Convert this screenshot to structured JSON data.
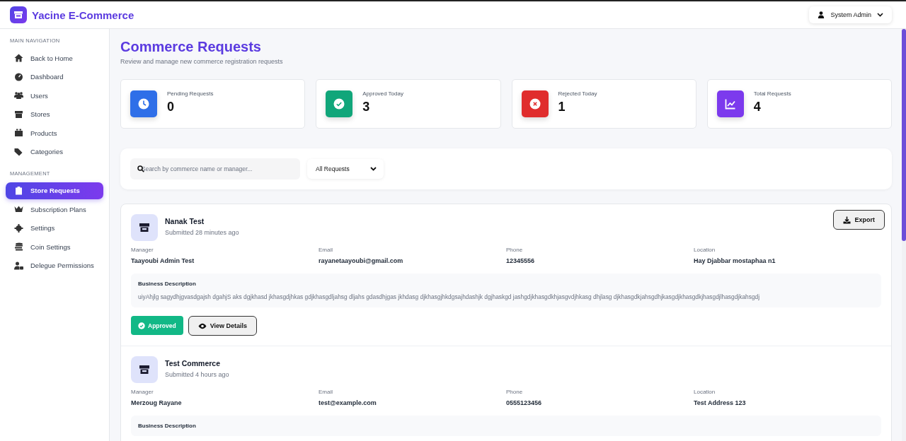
{
  "header": {
    "brand": "Yacine E-Commerce",
    "user_menu": "System Admin"
  },
  "sidebar": {
    "sections": [
      {
        "heading": "MAIN NAVIGATION",
        "items": [
          {
            "label": "Back to Home",
            "selected": false
          },
          {
            "label": "Dashboard",
            "selected": false
          },
          {
            "label": "Users",
            "selected": false
          },
          {
            "label": "Stores",
            "selected": false
          },
          {
            "label": "Products",
            "selected": false
          },
          {
            "label": "Categories",
            "selected": false
          }
        ]
      },
      {
        "heading": "MANAGEMENT",
        "items": [
          {
            "label": "Store Requests",
            "selected": true
          },
          {
            "label": "Subscription Plans",
            "selected": false
          },
          {
            "label": "Settings",
            "selected": false
          },
          {
            "label": "Coin Settings",
            "selected": false
          },
          {
            "label": "Delegue Permissions",
            "selected": false
          }
        ]
      }
    ]
  },
  "page": {
    "title": "Commerce Requests",
    "subtitle": "Review and manage new commerce registration requests"
  },
  "stats": [
    {
      "kind": "pending",
      "label": "Pending Requests",
      "value": "0"
    },
    {
      "kind": "approved",
      "label": "Approved Today",
      "value": "3"
    },
    {
      "kind": "rejected",
      "label": "Rejected Today",
      "value": "1"
    },
    {
      "kind": "total",
      "label": "Total Requests",
      "value": "4"
    }
  ],
  "filters": {
    "search": {
      "placeholder": "Search by commerce name or manager..."
    },
    "status_select": "All Requests"
  },
  "requests": [
    {
      "name": "Nanak Test",
      "submitted": "Submitted 28 minutes ago",
      "export_button": "Export",
      "fields": [
        {
          "label": "Manager",
          "value": "Taayoubi Admin Test"
        },
        {
          "label": "Email",
          "value": "rayanetaayoubi@gmail.com"
        },
        {
          "label": "Phone",
          "value": "12345556"
        },
        {
          "label": "Location",
          "value": "Hay Djabbar mostaphaa n1"
        }
      ],
      "description_label": "Business Description",
      "description": "uiyAhjlg sagydhjgvasdgajsh dgahjS aks dgjkhasd jkhasgdjhkas gdjkhasgdljahsg dljahs gdasdhjgas jkhdasg djkhasgjhkdgsajhdashjk dgjhaskgd jashgdjkhasgdkhjasgvdjhkasg dhjlasg djkhasgdkjahsgdhjkasgdjkhasgdkjhasgdjlhasgdjkahsgdj",
      "kind": "approved",
      "status_label": "Approved",
      "details_button": "View Details"
    },
    {
      "name": "Test Commerce",
      "submitted": "Submitted 4 hours ago",
      "fields": [
        {
          "label": "Manager",
          "value": "Merzoug Rayane"
        },
        {
          "label": "Email",
          "value": "test@example.com"
        },
        {
          "label": "Phone",
          "value": "0555123456"
        },
        {
          "label": "Location",
          "value": "Test Address 123"
        }
      ],
      "description_label": "Business Description"
    }
  ]
}
